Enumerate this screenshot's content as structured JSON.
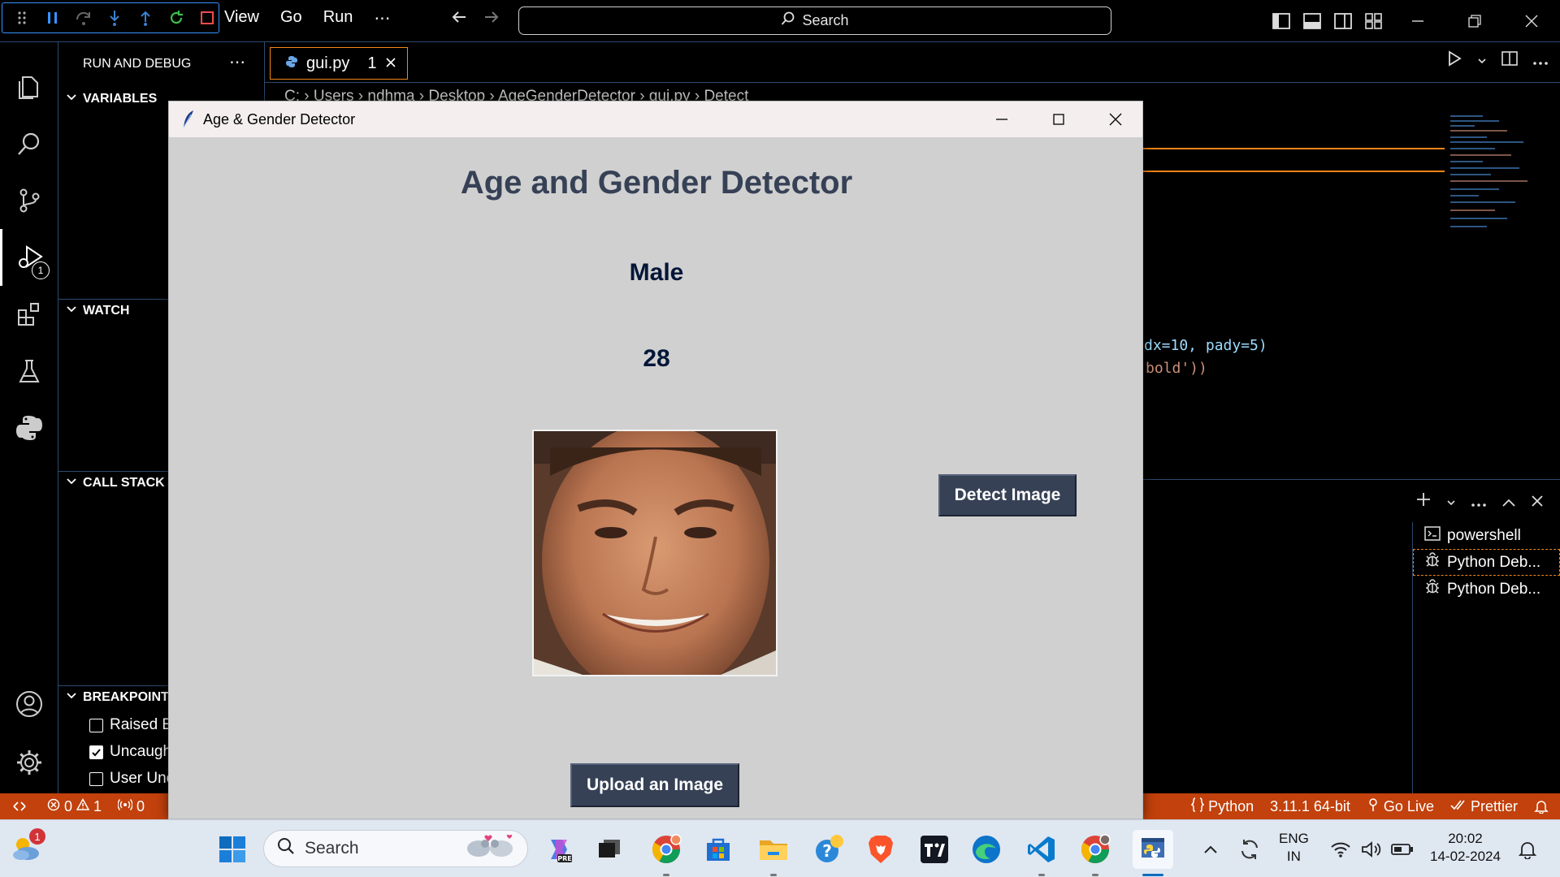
{
  "titlebar": {
    "menu": [
      "View",
      "Go",
      "Run"
    ],
    "more": "⋯",
    "search_label": "Search"
  },
  "sidebar": {
    "title": "RUN AND DEBUG",
    "more": "⋯",
    "sections": {
      "variables": "VARIABLES",
      "watch": "WATCH",
      "call_stack": "CALL STACK",
      "breakpoints": "BREAKPOINTS"
    },
    "breakpoints": [
      {
        "label": "Raised E",
        "checked": false
      },
      {
        "label": "Uncaugh",
        "checked": true
      },
      {
        "label": "User Unc",
        "checked": false
      }
    ],
    "debug_badge": "1"
  },
  "editor": {
    "tab": {
      "name": "gui.py",
      "problems": "1"
    },
    "breadcrumb": [
      "C:",
      "Users",
      "ndhma",
      "Desktop",
      "AgeGenderDetector",
      "gui.py",
      "Detect"
    ],
    "code_lines": [
      {
        "text": "dx=10, pady=5)",
        "kw": "pady"
      },
      {
        "text": "bold'))"
      }
    ]
  },
  "terminal": {
    "items": [
      "powershell",
      "Python Deb...",
      "Python Deb..."
    ]
  },
  "statusbar": {
    "errors": "0",
    "warnings": "1",
    "ports": "0",
    "language": "Python",
    "interpreter": "3.11.1 64-bit",
    "golive": "Go Live",
    "prettier": "Prettier"
  },
  "app": {
    "window_title": "Age & Gender Detector",
    "heading": "Age and Gender Detector",
    "gender": "Male",
    "age": "28",
    "detect_button": "Detect Image",
    "upload_button": "Upload an Image"
  },
  "taskbar": {
    "search_placeholder": "Search",
    "weather_badge": "1",
    "language": [
      "ENG",
      "IN"
    ],
    "time": "20:02",
    "date": "14-02-2024"
  },
  "colors": {
    "statusbar": "#c2410c",
    "tk_button": "#364156",
    "tk_heading": "#364156",
    "tk_text": "#011638",
    "tk_bg": "#d0d0d0",
    "accent": "#3794ff"
  }
}
